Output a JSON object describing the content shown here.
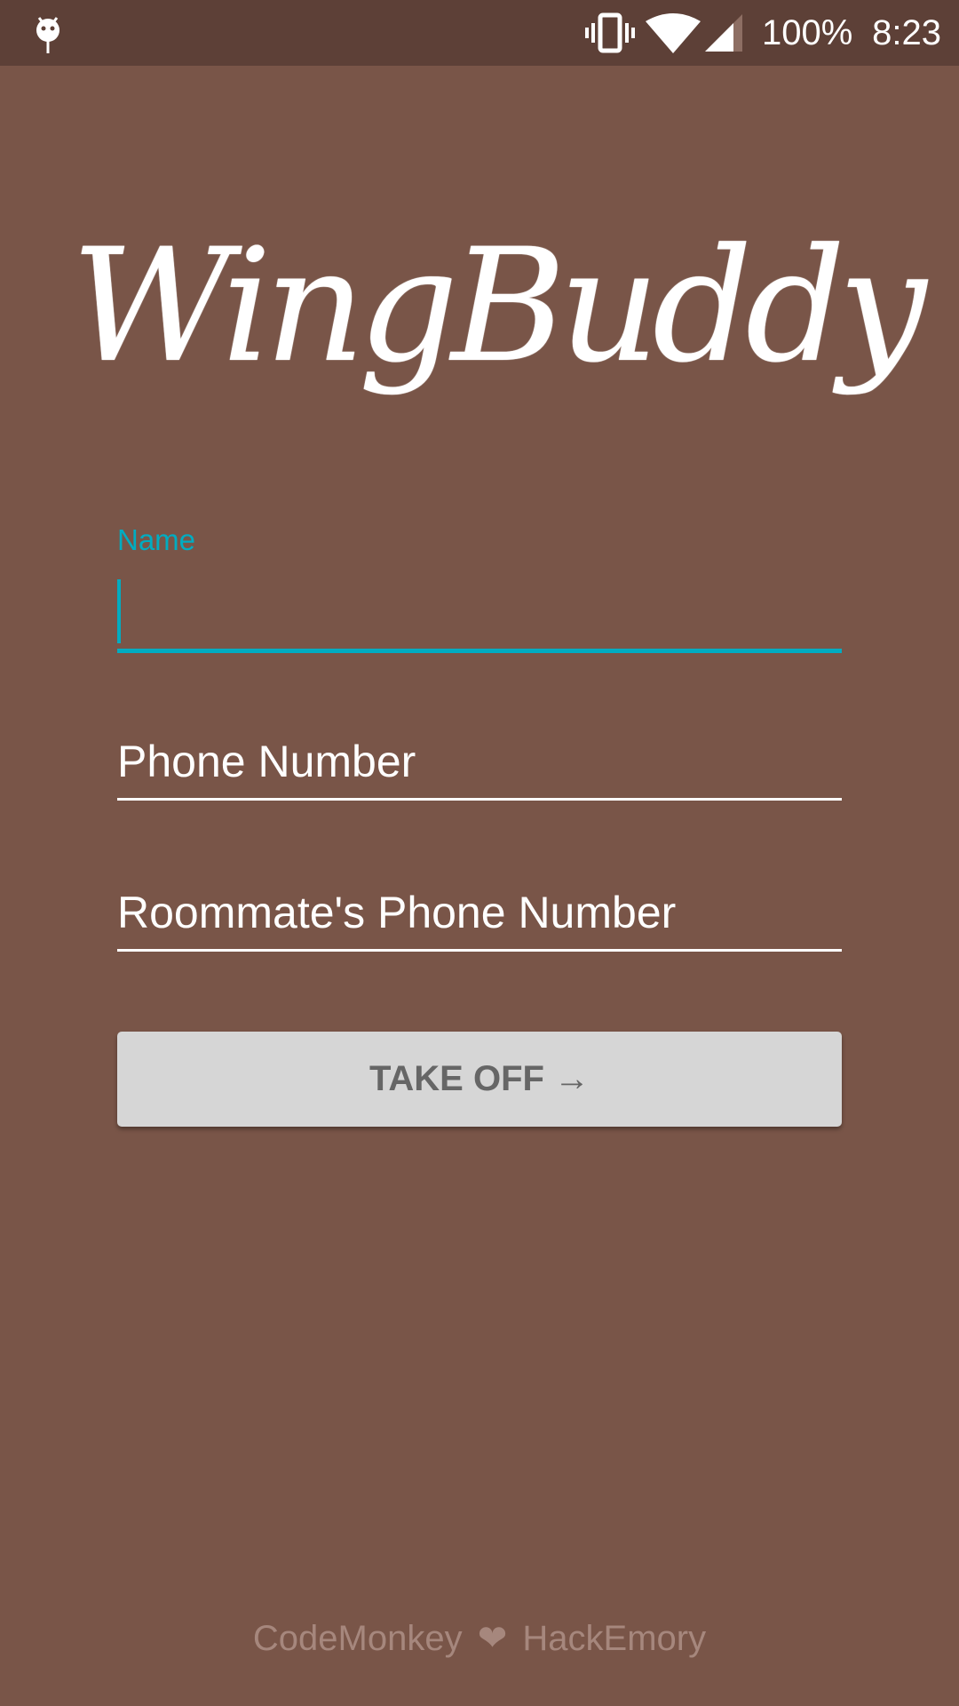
{
  "status_bar": {
    "left_icon": "android-debug-icon",
    "icons": [
      "vibrate-icon",
      "wifi-icon",
      "cell-signal-icon"
    ],
    "battery": "100%",
    "time": "8:23"
  },
  "app": {
    "logo_text": "WingBuddy"
  },
  "form": {
    "name_label": "Name",
    "name_value": "",
    "phone_hint": "Phone Number",
    "roommate_phone_hint": "Roommate's Phone Number",
    "submit_label": "TAKE OFF →"
  },
  "footer": {
    "left": "CodeMonkey",
    "heart": "❤",
    "right": "HackEmory"
  },
  "colors": {
    "background": "#795548",
    "status_bar": "#5d4037",
    "accent": "#00acc1",
    "button": "#d6d6d6",
    "footer_text": "#a6877d"
  }
}
